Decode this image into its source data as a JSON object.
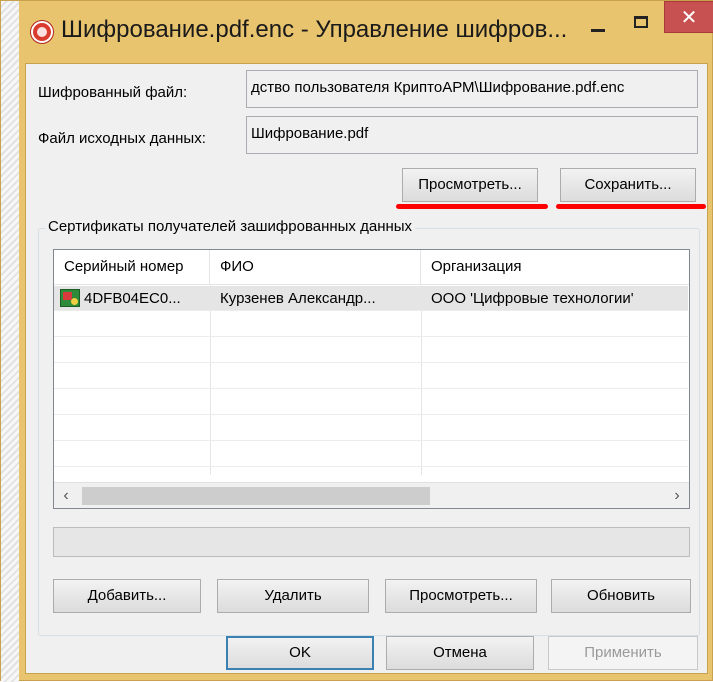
{
  "window": {
    "title": "Шифрование.pdf.enc - Управление шифров...",
    "close_glyph": "✕"
  },
  "form": {
    "encrypted_file_label": "Шифрованный файл:",
    "encrypted_file_value": "дство пользователя КриптоАРМ\\Шифрование.pdf.enc",
    "source_file_label": "Файл исходных данных:",
    "source_file_value": "Шифрование.pdf",
    "view_button": "Просмотреть...",
    "save_button": "Сохранить..."
  },
  "recipients": {
    "group_title": "Сертификаты получателей зашифрованных данных",
    "columns": [
      "Серийный номер",
      "ФИО",
      "Организация"
    ],
    "rows": [
      {
        "icon": "certificate-icon",
        "serial": "4DFB04EC0...",
        "name": "Курзенев Александр...",
        "organization": "ООО 'Цифровые технологии'"
      }
    ],
    "scroll_left": "‹",
    "scroll_right": "›",
    "add_button": "Добавить...",
    "delete_button": "Удалить",
    "view_button": "Просмотреть...",
    "refresh_button": "Обновить"
  },
  "dialog_buttons": {
    "ok": "OK",
    "cancel": "Отмена",
    "apply": "Применить"
  },
  "colors": {
    "title_bar": "#e9c46e",
    "close_button": "#c75050",
    "highlight": "#ff0000"
  }
}
